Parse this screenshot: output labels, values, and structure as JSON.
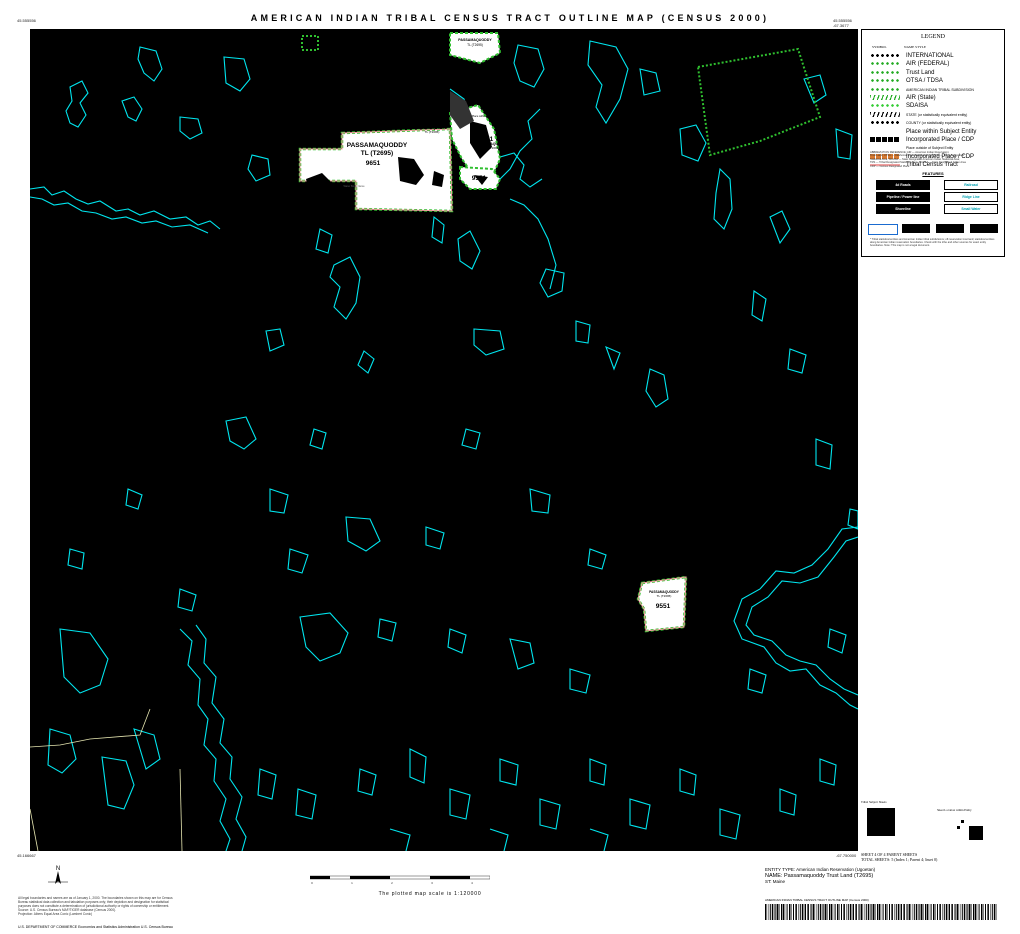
{
  "map_title": "AMERICAN INDIAN TRIBAL CENSUS TRACT OUTLINE MAP (CENSUS 2000)",
  "corner_coords": {
    "top_left": "45.555556",
    "top_right": "45.555556",
    "top_right_2": "-67.3677",
    "bottom_left": "45.166667",
    "bottom_right": "-67.750000"
  },
  "map_labels": {
    "entity_top": "PASSAMAQUODDY",
    "entity_top_sub": "TL (T2695)",
    "tract_255": "255",
    "passamaquoddy_main": "PASSAMAQUODDY",
    "tl_main": "TL (T2695)",
    "tract_9651": "9651",
    "tract_9551_a": "9551",
    "tract_9551_b": "9551",
    "tract_9551_c": "9551",
    "pass_small_1": "PASSAMAQUODDY",
    "pass_small_1_sub": "TL (T2695)",
    "pass_small_2": "PASSAMAQUODDY",
    "pass_small_2_sub": "TL (T2695)",
    "pass_small_3": "PASSAMAQUODDY",
    "pass_small_3_sub": "TL (T2695)",
    "small_place": "Place within Subject Entity",
    "lake_label": "Water Body Name"
  },
  "legend": {
    "heading": "LEGEND",
    "col_symbol": "SYMBOL",
    "col_name": "NAME STYLE",
    "items": [
      {
        "label": "INTERNATIONAL",
        "color": "#000000",
        "style": "boundary"
      },
      {
        "label": "AIR (FEDERAL)",
        "color": "#22aa22",
        "style": "dots"
      },
      {
        "label": "Trust Land",
        "color": "#22aa22",
        "style": "dots"
      },
      {
        "label": "OTSA / TDSA",
        "color": "#22aa22",
        "style": "dots"
      },
      {
        "label": "AMERICAN INDIAN TRIBAL SUBDIVISION",
        "color": "#22aa22",
        "style": "dots"
      },
      {
        "label": "AIR (State)",
        "color": "#22aa22",
        "style": "dash"
      },
      {
        "label": "SDAISA",
        "color": "#33cc33",
        "style": "dots"
      },
      {
        "label": "STATE  (or statistically equivalent entity)",
        "color": "#000000",
        "style": "dash"
      },
      {
        "label": "COUNTY  (or statistically equivalent entity)",
        "color": "#000000",
        "style": "boundary"
      },
      {
        "label": "Place within Subject Entity",
        "color": "#000000",
        "style": "none"
      },
      {
        "label": "Incorporated Place / CDP",
        "color": "#000000",
        "style": "block"
      },
      {
        "label": "Place outside of Subject Entity",
        "color": "#000000",
        "style": "none"
      },
      {
        "label": "Incorporated Place / CDP",
        "color": "#d87a30",
        "style": "block"
      },
      {
        "label": "Tribal Census Tract",
        "color": "#f2a0a0",
        "style": "line"
      }
    ],
    "notes": [
      "ABBREVIATION REFERENCE: AIR — American Indian Reservation;",
      "Trust Land; OTSA — Oklahoma Tribal Statistical Area; TDSA — Tribal Designated",
      "Statistical Area; SDAISA — State Designated American Indian Statistical Area;",
      "TRS — Tribal Designated Statistical Area; SDAISA — State Designated Indian Area",
      "CDP — Census Designated Place"
    ],
    "features_heading": "FEATURES",
    "features": [
      "4d Roads",
      "Railroad",
      "Pipeline / Power line",
      "Ridge Line",
      "Shoreline",
      "Small Water"
    ],
    "footnote": "* Tribal statistical entities and American Indian tribal subdivisions; off-reservation trust land; statistical entities along American Indian reservation boundaries. Check with the tribe and other sources for exact entity boundaries. Note: This map is not a legal document."
  },
  "inset": {
    "left_title": "Tribal Subject Sheets",
    "right_title": "Sheet Location within Entity"
  },
  "sheet_info": {
    "line1": "SHEET 4 OF 4 PARENT SHEETS",
    "line2": "TOTAL SHEETS: 5 (Index 1; Parent 4; Inset 0)"
  },
  "entity_info": {
    "entity_type": "ENTITY TYPE: American Indian Reservation (Ugoetan)",
    "name": "NAME: Passamaquoddy Trust Land (T2695)",
    "state": "ST: Maine"
  },
  "scale_text": "The plotted map scale is 1:120000",
  "scale_ticks": [
    "0",
    "1",
    "2",
    "3",
    "4"
  ],
  "disclaimer": [
    "All legal boundaries and names are as of January 1, 2000. The boundaries shown on this map are for Census",
    "Bureau statistical data collection and tabulation purposes only; their depiction and designation for statistical",
    "purposes does not constitute a determination of jurisdictional authority or rights of ownership or entitlement.",
    "Source: U.S. Census Bureau's MAF/TIGER database (Census 2000).",
    "Projection: Albers Equal Area Conic (Lambert Conic)"
  ],
  "dept": "U.S. DEPARTMENT OF COMMERCE  Economics and Statistics Administration  U.S. Census Bureau",
  "barcode_label": "AMERICAN INDIAN TRIBAL CENSUS TRACT OUTLINE MAP (Census 2000)",
  "colors": {
    "map_bg": "#000000",
    "water": "#00e5ee",
    "tribal_fill": "#ffffff",
    "tribal_border_green": "#2fbf2f",
    "tract_pink": "#f2a0a0"
  }
}
